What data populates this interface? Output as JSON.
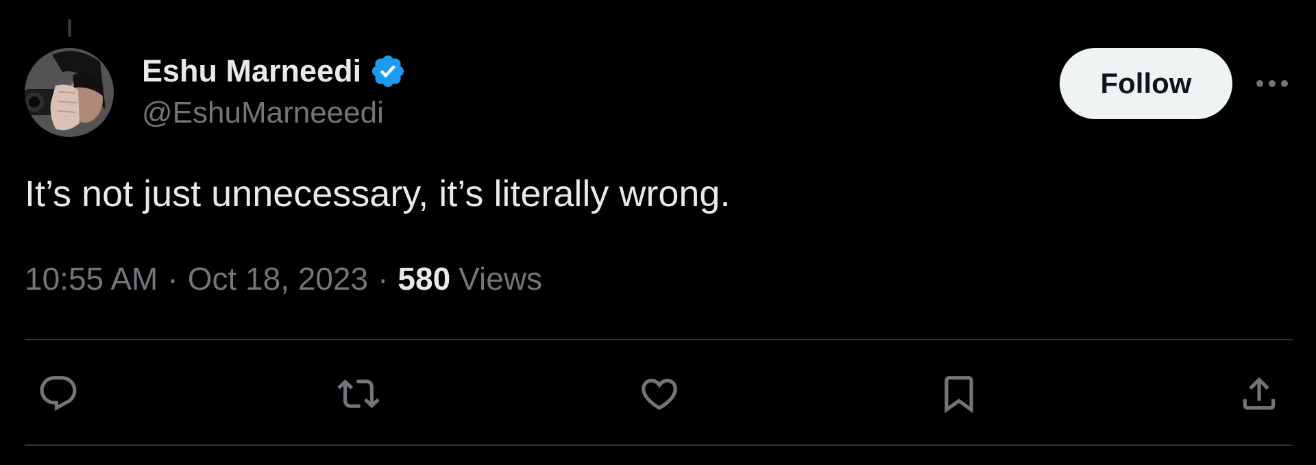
{
  "author": {
    "display_name": "Eshu Marneedi",
    "handle": "@EshuMarneeedi",
    "verified": true,
    "avatar_icon": "avatar-photo"
  },
  "header": {
    "follow_label": "Follow",
    "more_icon": "more-dots-icon"
  },
  "tweet": {
    "text": "It’s not just unnecessary, it’s literally wrong.",
    "time": "10:55 AM",
    "separator": "·",
    "date": "Oct 18, 2023",
    "views_count": "580",
    "views_label": "Views"
  },
  "actions": [
    {
      "name": "reply",
      "icon": "reply-icon"
    },
    {
      "name": "retweet",
      "icon": "retweet-icon"
    },
    {
      "name": "like",
      "icon": "heart-icon"
    },
    {
      "name": "bookmark",
      "icon": "bookmark-icon"
    },
    {
      "name": "share",
      "icon": "share-icon"
    }
  ],
  "colors": {
    "background": "#000000",
    "text_primary": "#e7e9ea",
    "text_secondary": "#71767b",
    "verified_blue": "#1d9bf0",
    "follow_bg": "#eff3f4",
    "divider": "#2f3336"
  }
}
